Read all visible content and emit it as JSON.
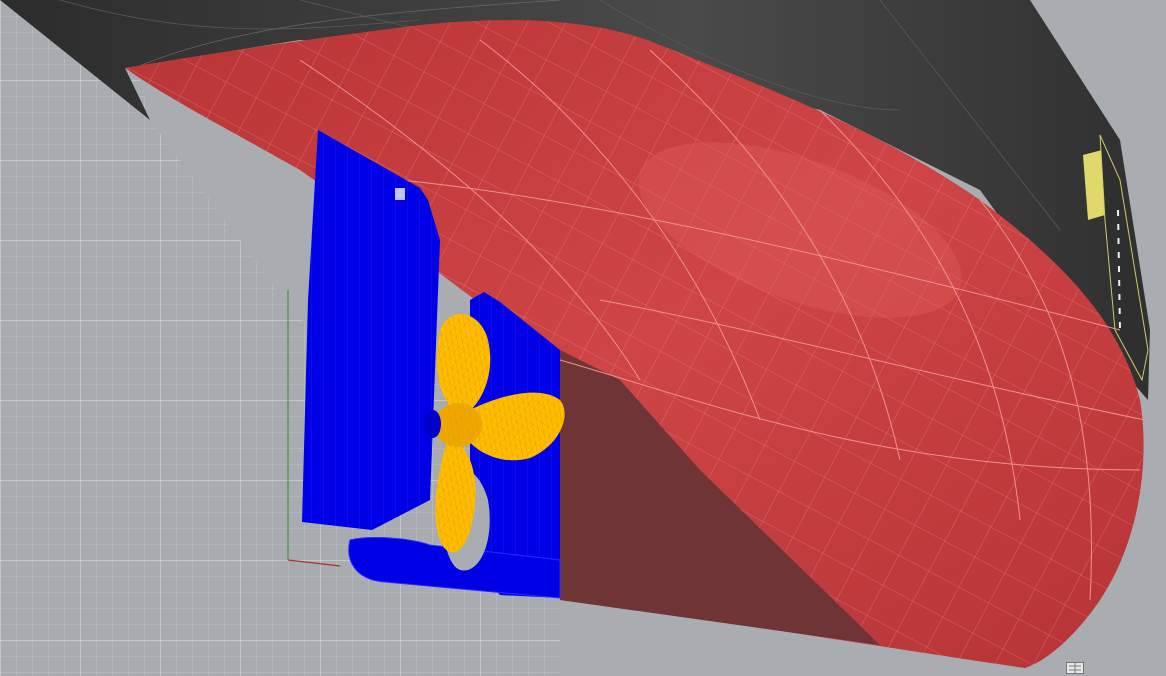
{
  "viewport": {
    "label": "",
    "background": "#a9adb2",
    "grid_color": "#c2c6cb"
  },
  "model": {
    "hull_upper_color": "#3b3b3b",
    "hull_bottom_color": "#c73c3c",
    "hull_wireframe_color": "#e87a7a",
    "skeg_shadow_color": "#6e3436",
    "rudder_color": "#0000e6",
    "propeller_color": "#ffbe00",
    "deck_accent_color": "#e0d86a"
  },
  "icons": {
    "axis_widget": "axis-gizmo-icon"
  }
}
